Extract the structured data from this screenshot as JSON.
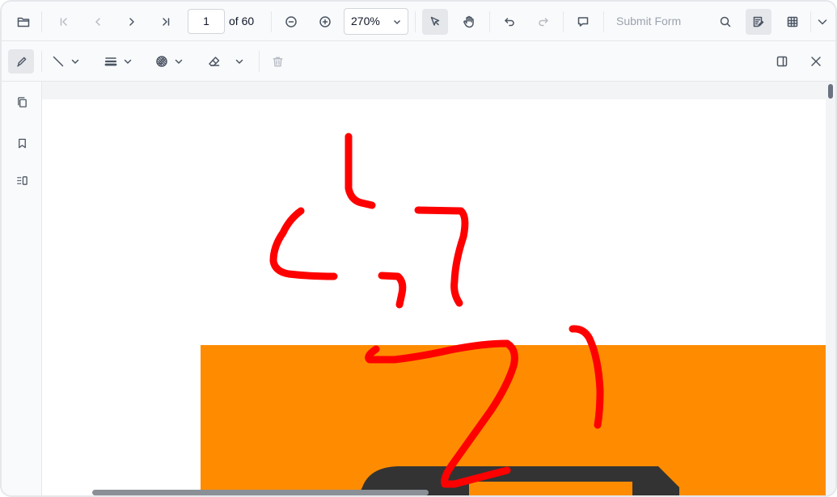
{
  "toolbar": {
    "page_current": "1",
    "page_total": "of 60",
    "zoom": "270%",
    "submit_form": "Submit Form"
  },
  "annotation_toolbar": {
    "tools": [
      "ink-pen",
      "line",
      "thickness",
      "opacity",
      "eraser",
      "delete"
    ]
  },
  "sidebar": {
    "items": [
      "page-thumbnails",
      "bookmarks",
      "organize-pages"
    ]
  },
  "document": {
    "banner_color": "#ff8c00",
    "ink_color": "#ff0000",
    "dark_shape_color": "#333333"
  }
}
